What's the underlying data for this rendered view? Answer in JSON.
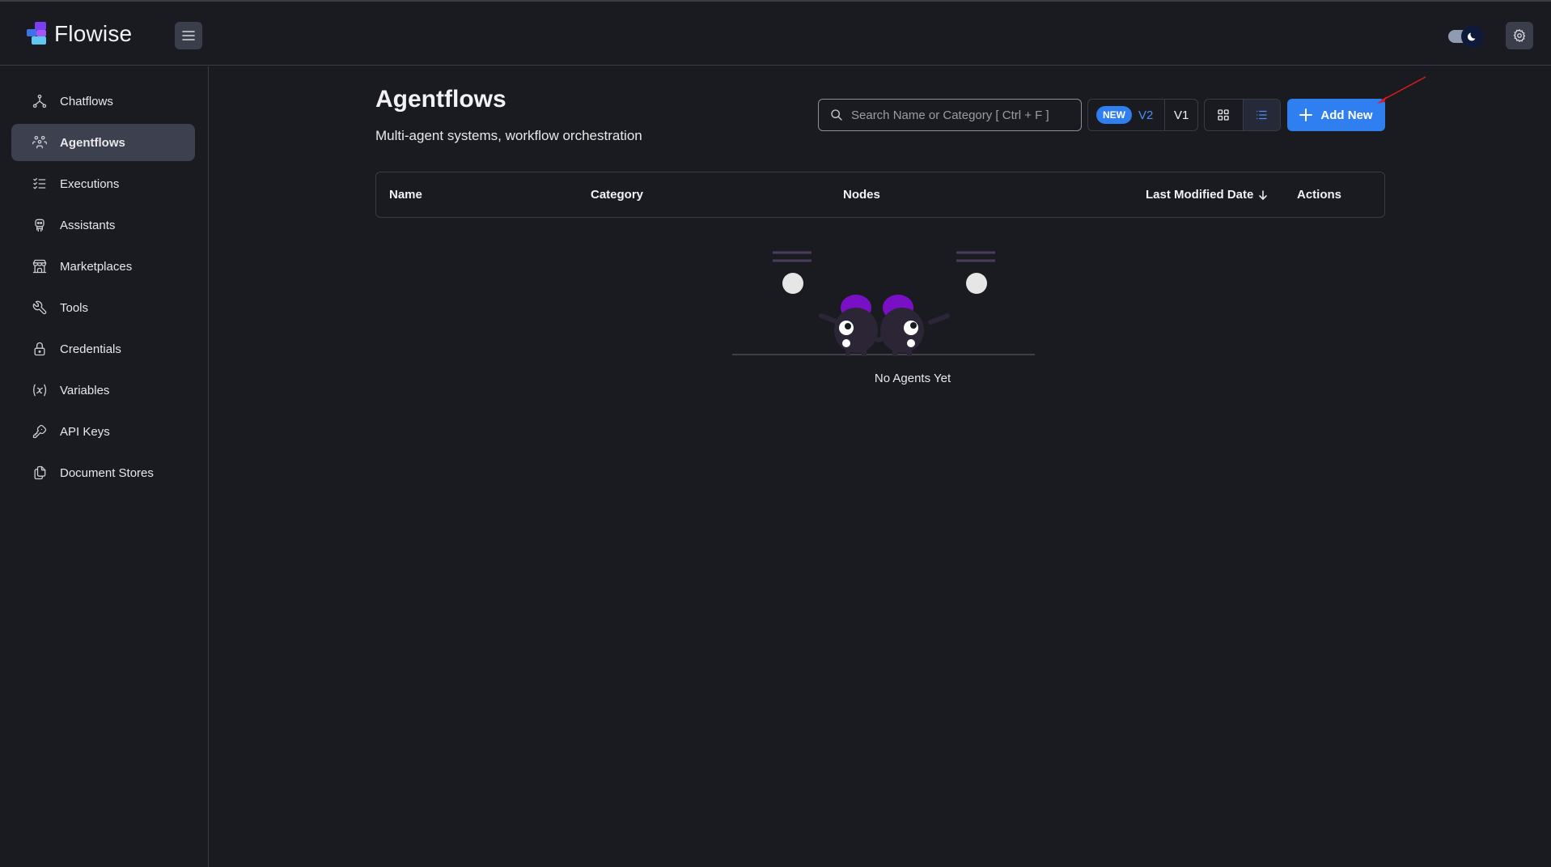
{
  "app": {
    "name": "Flowise"
  },
  "sidebar": {
    "items": [
      {
        "label": "Chatflows",
        "icon": "hierarchy-icon",
        "active": false
      },
      {
        "label": "Agentflows",
        "icon": "users-group-icon",
        "active": true
      },
      {
        "label": "Executions",
        "icon": "list-check-icon",
        "active": false
      },
      {
        "label": "Assistants",
        "icon": "robot-icon",
        "active": false
      },
      {
        "label": "Marketplaces",
        "icon": "store-icon",
        "active": false
      },
      {
        "label": "Tools",
        "icon": "tool-icon",
        "active": false
      },
      {
        "label": "Credentials",
        "icon": "lock-icon",
        "active": false
      },
      {
        "label": "Variables",
        "icon": "variable-icon",
        "active": false
      },
      {
        "label": "API Keys",
        "icon": "key-icon",
        "active": false
      },
      {
        "label": "Document Stores",
        "icon": "files-icon",
        "active": false
      }
    ]
  },
  "page": {
    "title": "Agentflows",
    "subtitle": "Multi-agent systems, workflow orchestration"
  },
  "search": {
    "placeholder": "Search Name or Category [ Ctrl + F ]",
    "value": ""
  },
  "version_toggle": {
    "badge": "NEW",
    "v2": "V2",
    "v1": "V1",
    "selected": "V2"
  },
  "view_toggle": {
    "selected": "list"
  },
  "add_button": {
    "label": "Add New"
  },
  "table": {
    "columns": [
      "Name",
      "Category",
      "Nodes",
      "Last Modified Date",
      "Actions"
    ],
    "sort_column": "Last Modified Date",
    "sort_direction": "desc",
    "rows": []
  },
  "empty_state": {
    "message": "No Agents Yet"
  },
  "colors": {
    "background": "#1a1b21",
    "accent": "#2f7ff0",
    "active_nav": "#3d404e",
    "illustration_purple": "#7a10c6"
  }
}
